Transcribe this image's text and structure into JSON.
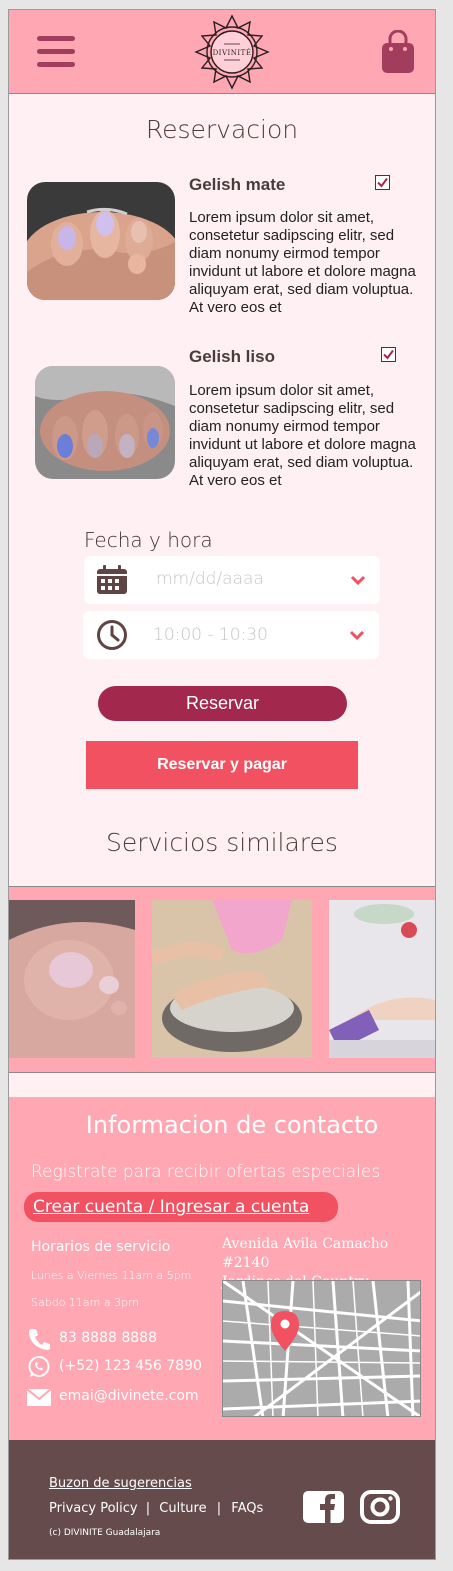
{
  "header": {
    "logo_text": "DIVINITÉ",
    "menu_icon": "hamburger-menu-icon",
    "cart_icon": "shopping-bag-icon"
  },
  "reservation": {
    "title": "Reservacion",
    "products": [
      {
        "name": "Gelish mate",
        "checked": true,
        "description": "Lorem ipsum dolor sit amet, consetetur sadipscing elitr, sed diam nonumy eirmod tempor invidunt ut labore et dolore magna aliquyam erat, sed diam voluptua. At vero eos et"
      },
      {
        "name": "Gelish liso",
        "checked": true,
        "description": "Lorem ipsum dolor sit amet, consetetur sadipscing elitr, sed diam nonumy eirmod tempor invidunt ut labore et dolore magna aliquyam erat, sed diam voluptua. At vero eos et"
      }
    ],
    "date_time_label": "Fecha y hora",
    "date_placeholder": "mm/dd/aaaa",
    "time_placeholder": "10:00 - 10:30",
    "reserve_button": "Reservar",
    "reserve_pay_button": "Reservar y pagar"
  },
  "similar": {
    "title": "Servicios similares"
  },
  "contact": {
    "title": "Informacion de contacto",
    "promo": "Registrate para recibir ofertas especiales",
    "cta": "Crear cuenta / Ingresar a cuenta",
    "hours_title": "Horarios de servicio",
    "hours_weekdays": "Lunes a Viernes 11am a 5pm",
    "hours_saturday": "Sabdo 11am a 3pm",
    "phone": "83 8888 8888",
    "whatsapp": "(+52) 123 456 7890",
    "email": "emai@divinete.com",
    "address_line1": "Avenida Avila Camacho #2140",
    "address_line2": "Jardines del Country"
  },
  "footer": {
    "suggestions": "Buzon de sugerencias",
    "privacy": "Privacy Policy",
    "culture": "Culture",
    "faqs": "FAQs",
    "separator": "|",
    "copyright": "(c) DIVINITE Guadalajara"
  },
  "colors": {
    "header_pink": "#ffa8b3",
    "background": "#fff0f3",
    "accent_red": "#f25161",
    "wine": "#a2294d",
    "footer_brown": "#654b4b"
  }
}
